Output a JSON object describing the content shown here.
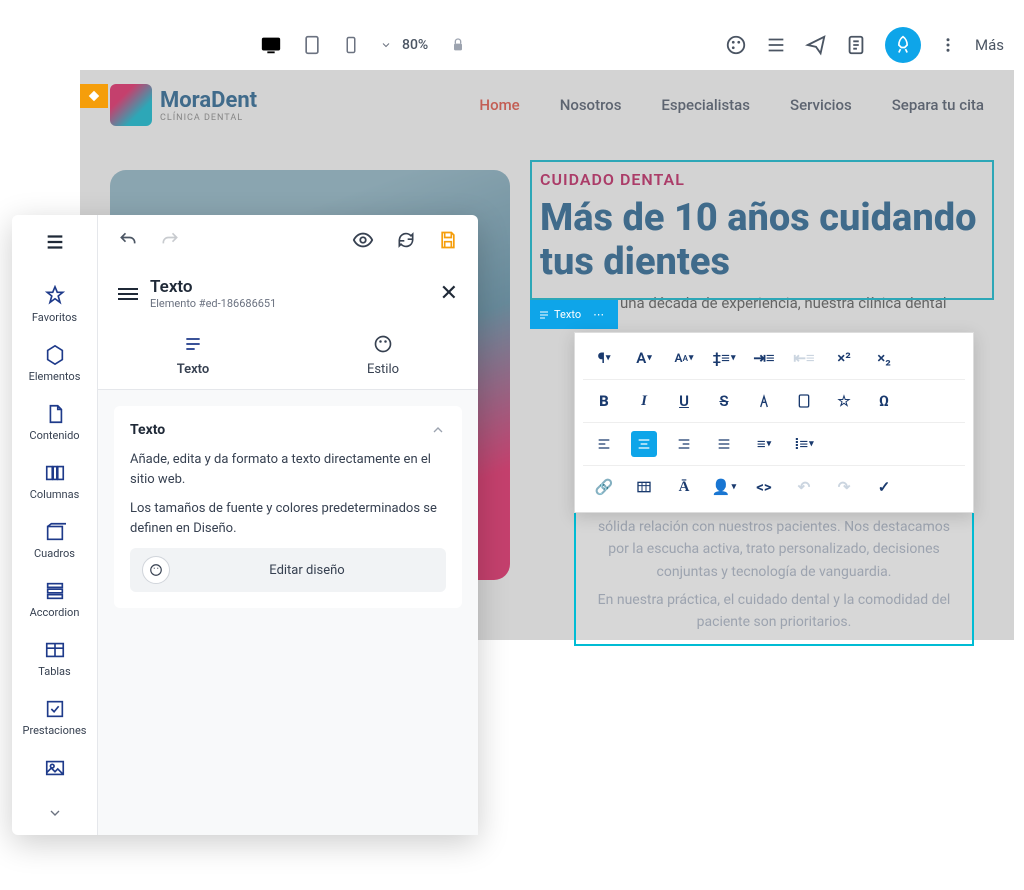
{
  "toolbar": {
    "zoom": "80%",
    "more_label": "Más"
  },
  "site": {
    "logo_name": "MoraDent",
    "logo_sub": "CLÍNICA DENTAL",
    "nav": {
      "home": "Home",
      "about": "Nosotros",
      "specialists": "Especialistas",
      "services": "Servicios",
      "appointment": "Separa tu cita"
    },
    "eyebrow": "CUIDADO DENTAL",
    "headline": "Más de 10 años cuidando tus dientes",
    "intro_partial": "una década de experiencia, nuestra clínica dental",
    "text_badge": "Texto",
    "editable_p1": "Con más de una década de experiencia, nuestra clínica dental ofrece servicios de alta calidad, respaldados por una sólida relación con nuestros pacientes. Nos destacamos por la escucha activa, trato personalizado, decisiones conjuntas y tecnología de vanguardia.",
    "editable_p2": "En nuestra práctica, el cuidado dental y la comodidad del paciente son prioritarios."
  },
  "editor": {
    "sidebar": {
      "favorites": "Favoritos",
      "elements": "Elementos",
      "content": "Contenido",
      "columns": "Columnas",
      "boxes": "Cuadros",
      "accordion": "Accordion",
      "tables": "Tablas",
      "features": "Prestaciones"
    },
    "title": "Texto",
    "subtitle": "Elemento #ed-186686651",
    "tabs": {
      "text": "Texto",
      "style": "Estilo"
    },
    "card": {
      "title": "Texto",
      "desc1": "Añade, edita y da formato a texto directamente en el sitio web.",
      "desc2": "Los tamaños de fuente y colores predeterminados se definen en Diseño.",
      "button": "Editar diseño"
    }
  }
}
